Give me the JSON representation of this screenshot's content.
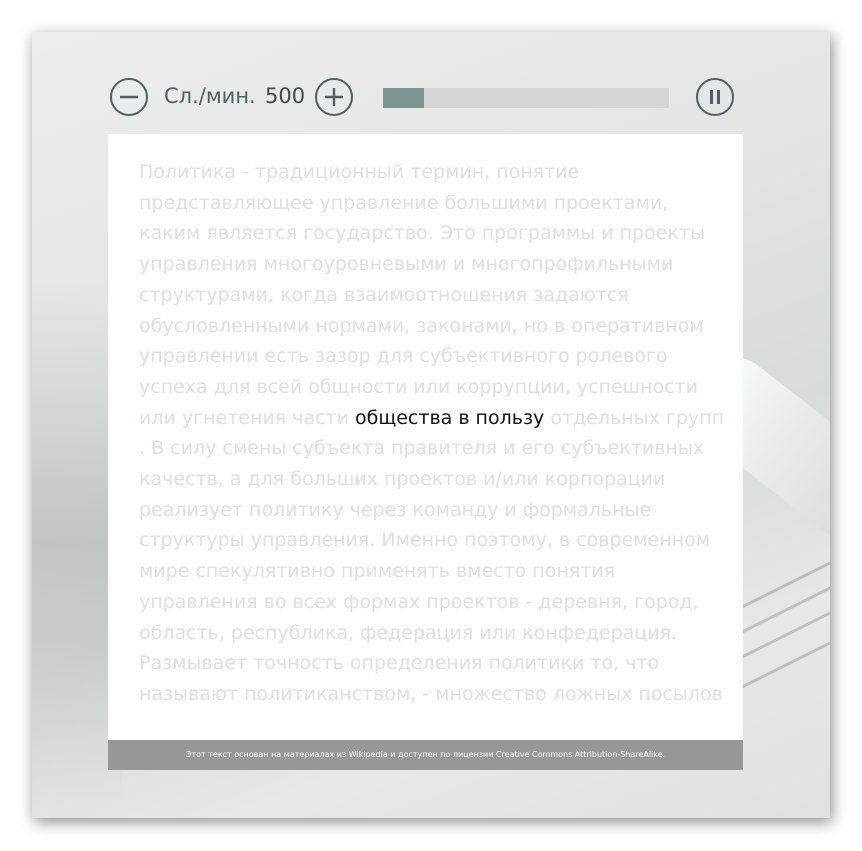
{
  "controls": {
    "wpm_label": "Сл./мин.",
    "wpm_value": "500",
    "progress": 0.145
  },
  "reader": {
    "text_before": "Политика - традиционный термин, понятие представляющее управление большими проектами, каким является государство. Это программы и проекты управления многоуровневыми и многопрофильными структурами, когда взаимоотношения задаются обусловленными нормами, законами, но в оперативном управлении есть зазор для субъективного ролевого успеха для всей общности или коррупции, успешности или угнетения части ",
    "highlighted": "общества в пользу",
    "text_after": " отдельных групп . В силу смены субъекта правителя и его субъективных качеств, а для больших проектов и/или корпорации реализует политику через команду и формальные структуры управления. Именно поэтому, в современном мире спекулятивно применять вместо понятия управления во всех формах проектов - деревня, город, область, республика, федерация или конфедерация. Размывает точность определения политики то, что называют политиканством, - множество ложных посылов"
  },
  "footer": {
    "attribution": "Этот текст основан на материалах из Wikipedia и доступен по лицензии Creative Commons Attribution-ShareAlike."
  },
  "colors": {
    "accent": "#4a6160",
    "progress_fill": "#7a9493",
    "progress_track": "#d3d6d5",
    "faded_text": "#dde0df",
    "current_text": "#111111",
    "footer_bg": "#979797"
  },
  "icons": {
    "decrease": "minus-circle-icon",
    "increase": "plus-circle-icon",
    "pause": "pause-circle-icon"
  }
}
